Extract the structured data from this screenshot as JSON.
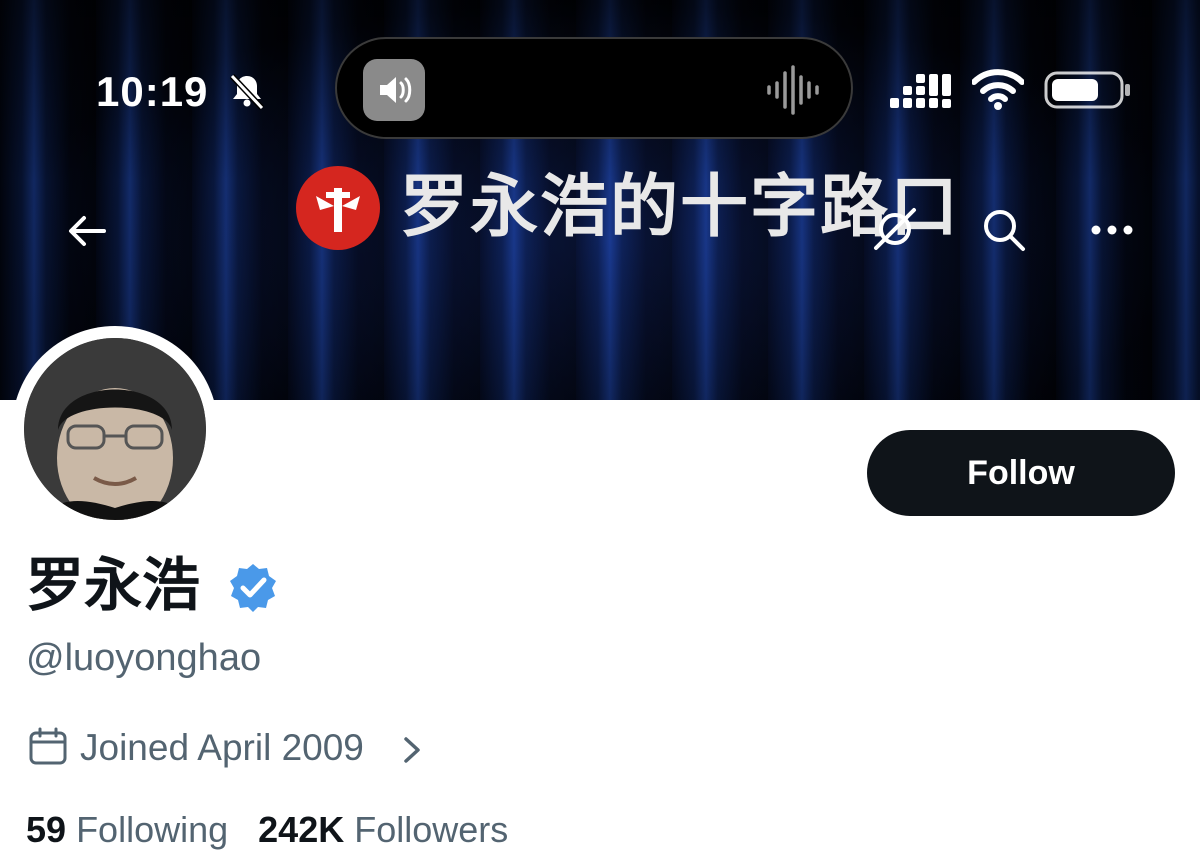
{
  "status_bar": {
    "time": "10:19"
  },
  "banner": {
    "channel_title": "罗永浩的十字路口",
    "logo_color": "#d5261f"
  },
  "nav": {
    "back": "back-arrow-icon",
    "grok": "grok-icon",
    "search": "search-icon",
    "more": "more-icon"
  },
  "profile": {
    "display_name": "罗永浩",
    "handle": "@luoyonghao",
    "verified_color": "#4a99e9",
    "joined": "Joined April 2009",
    "following_count": "59",
    "following_label": "Following",
    "followers_count": "242K",
    "followers_label": "Followers"
  },
  "actions": {
    "follow_label": "Follow"
  }
}
